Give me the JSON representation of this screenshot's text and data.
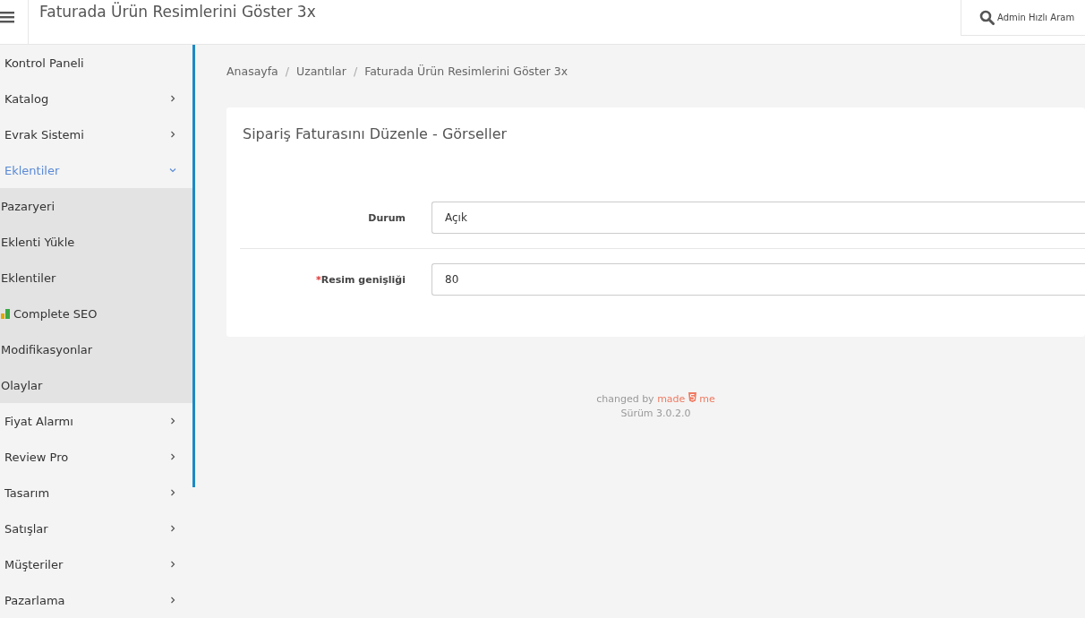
{
  "header": {
    "title": "Faturada Ürün Resimlerini Göster 3x",
    "search": {
      "placeholder": "Admin Hızlı Aram"
    }
  },
  "sidebar": {
    "items": [
      {
        "label": "Kontrol Paneli"
      },
      {
        "label": "Katalog",
        "expanded": false
      },
      {
        "label": "Evrak Sistemi",
        "expanded": false
      },
      {
        "label": "Eklentiler",
        "expanded": true,
        "children": [
          {
            "label": "Pazaryeri"
          },
          {
            "label": "Eklenti Yükle"
          },
          {
            "label": "Eklentiler"
          },
          {
            "label": "Complete SEO",
            "kind": "icon"
          },
          {
            "label": "Modifikasyonlar"
          },
          {
            "label": "Olaylar"
          }
        ]
      },
      {
        "label": "Fiyat Alarmı",
        "expanded": false
      },
      {
        "label": "Review Pro",
        "expanded": false
      },
      {
        "label": "Tasarım",
        "expanded": false
      },
      {
        "label": "Satışlar",
        "expanded": false
      },
      {
        "label": "Müşteriler",
        "expanded": false
      },
      {
        "label": "Pazarlama",
        "expanded": false
      }
    ]
  },
  "breadcrumb": {
    "separator": "/",
    "items": [
      "Anasayfa",
      "Uzantılar",
      "Faturada Ürün Resimlerini Göster 3x"
    ]
  },
  "card": {
    "title": "Sipariş Faturasını Düzenle - Görseller",
    "fields": [
      {
        "label": "Durum",
        "value": "Açık"
      },
      {
        "label": "Resim genişliği",
        "required_mark": "*",
        "value": "80"
      }
    ]
  },
  "footer": {
    "changed_by": "changed by",
    "made": "made",
    "me": "me",
    "version": "Sürüm 3.0.2.0"
  }
}
